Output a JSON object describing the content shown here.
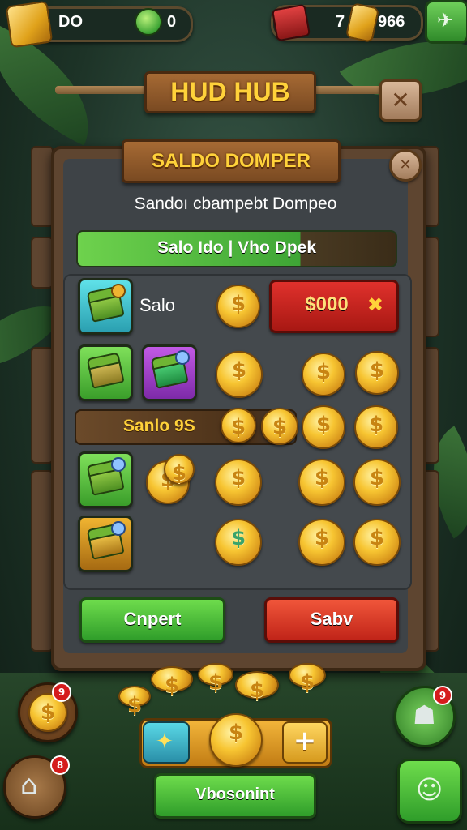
{
  "hud": {
    "left_value": "DO",
    "mid_value": "0",
    "right_value": "7",
    "right_value2": "966"
  },
  "title_banner": {
    "label": "HUD HUB",
    "close_glyph": "✕"
  },
  "dialog": {
    "header": "SALDO DOMPER",
    "close_glyph": "✕",
    "subtitle": "Sandoı cbampebt Dompeo",
    "progress_label": "Salo Ido | Vho Dpek",
    "row1_label": "Salо",
    "price_button": "$000",
    "price_icon": "✖",
    "row3_label": "Sanlo 9S",
    "confirm_button": "Cnpert",
    "cancel_button": "Sabv"
  },
  "footer": {
    "plus_glyph": "+",
    "bottom_button": "Vbosonint",
    "badge_left_top": "9",
    "badge_left_bottom": "8",
    "badge_right": "9"
  },
  "colors": {
    "gold": "#f7c532",
    "accent_green": "#3ea535",
    "accent_red": "#c8211c",
    "wood": "#7a4a22"
  },
  "icons": [
    "gold-bar-icon",
    "coin-icon",
    "treasure-chest-icon",
    "dollar-coin-icon",
    "close-icon",
    "plus-icon",
    "house-icon",
    "spirit-icon",
    "gear-icon"
  ]
}
